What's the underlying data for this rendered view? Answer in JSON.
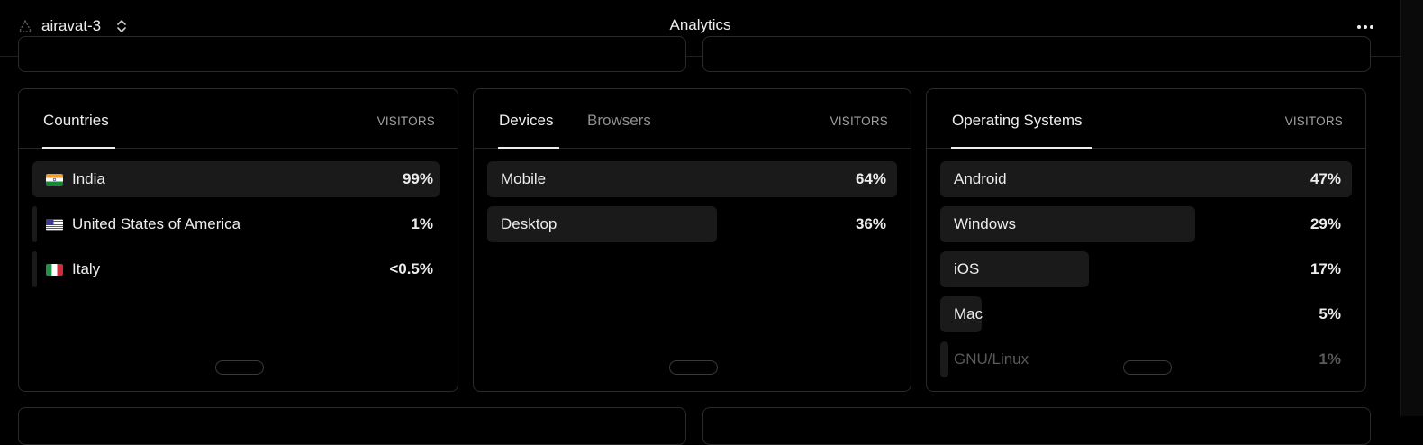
{
  "header": {
    "project_name": "airavat-3",
    "title": "Analytics",
    "icons": [
      "logo-icon",
      "chevrons-updown-icon",
      "more-horizontal-icon"
    ]
  },
  "panels": {
    "countries": {
      "tab": "Countries",
      "column": "VISITORS",
      "rows": [
        {
          "label": "India",
          "value": "99%",
          "flag": "india-flag-icon",
          "fill": 0.99
        },
        {
          "label": "United States of America",
          "value": "1%",
          "flag": "usa-flag-icon",
          "fill": 0.01
        },
        {
          "label": "Italy",
          "value": "<0.5%",
          "flag": "italy-flag-icon",
          "fill": 0.005
        }
      ]
    },
    "devices": {
      "tabs": [
        "Devices",
        "Browsers"
      ],
      "column": "VISITORS",
      "rows": [
        {
          "label": "Mobile",
          "value": "64%",
          "fill": 1.0
        },
        {
          "label": "Desktop",
          "value": "36%",
          "fill": 0.56
        }
      ]
    },
    "os": {
      "tab": "Operating Systems",
      "column": "VISITORS",
      "rows": [
        {
          "label": "Android",
          "value": "47%",
          "fill": 1.0
        },
        {
          "label": "Windows",
          "value": "29%",
          "fill": 0.62
        },
        {
          "label": "iOS",
          "value": "17%",
          "fill": 0.36
        },
        {
          "label": "Mac",
          "value": "5%",
          "fill": 0.1
        },
        {
          "label": "GNU/Linux",
          "value": "1%",
          "fill": 0.02
        }
      ]
    }
  },
  "colors": {
    "background": "#000000",
    "bar": "#1a1a1a",
    "border": "#2a2a2a",
    "text": "#ededed",
    "muted": "#8f8f8f"
  }
}
